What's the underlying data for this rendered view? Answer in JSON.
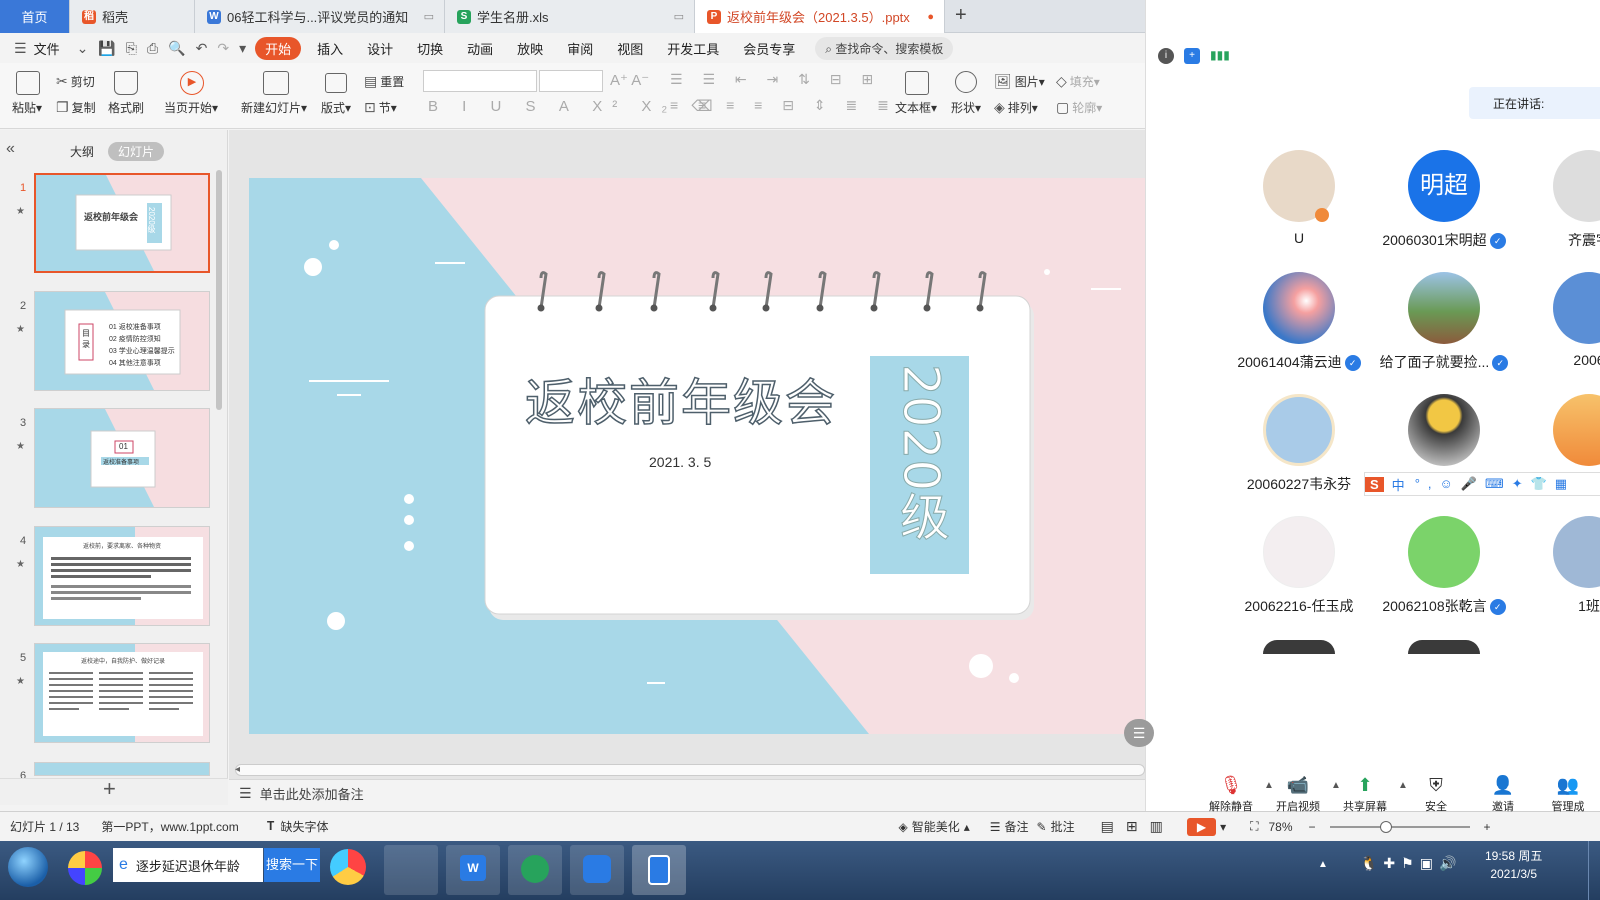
{
  "tabs": {
    "home": "首页",
    "daoke": "稻壳",
    "doc": "06轻工科学与...评议党员的通知",
    "xls": "学生名册.xls",
    "pptx": "返校前年级会（2021.3.5）.pptx",
    "add": "+"
  },
  "menu": {
    "file": "文件",
    "items": [
      "开始",
      "插入",
      "设计",
      "切换",
      "动画",
      "放映",
      "审阅",
      "视图",
      "开发工具",
      "会员专享"
    ],
    "search": "查找命令、搜索模板"
  },
  "ribbon": {
    "paste": "粘贴",
    "cut": "剪切",
    "copy": "复制",
    "format_painter": "格式刷",
    "from_current": "当页开始",
    "new_slide": "新建幻灯片",
    "layout": "版式",
    "reset": "重置",
    "section": "节",
    "textbox": "文本框",
    "shape": "形状",
    "picture": "图片",
    "arrange": "排列",
    "fill": "填充",
    "outline": "轮廓"
  },
  "leftpanel": {
    "outline_tab": "大纲",
    "slides_tab": "幻灯片",
    "slide_numbers": [
      "1",
      "2",
      "3",
      "4",
      "5",
      "6"
    ],
    "thumb1_title": "返校前年级会",
    "thumb1_year": "2020级",
    "thumb2_label": "目录",
    "thumb2_items": [
      "01 返校准备事项",
      "02 疫情防控须知",
      "03 学业心理温馨提示",
      "04 其他注意事项"
    ],
    "thumb3_num": "01",
    "thumb3_label": "返校准备事项",
    "thumb4_title": "返校前，要求离家、各种物资",
    "thumb5_title": "返校途中，自我防护、做好记录",
    "add_icon": "+"
  },
  "slide": {
    "title": "返校前年级会",
    "date": "2021. 3. 5",
    "year_label": "2020级"
  },
  "notes_placeholder": "单击此处添加备注",
  "status": {
    "slide_count": "幻灯片 1 / 13",
    "theme": "第一PPT，www.1ppt.com",
    "missing_font": "缺失字体",
    "beautify": "智能美化",
    "notes": "备注",
    "comments": "批注",
    "zoom": "78%"
  },
  "meeting": {
    "speaking": "正在讲话:",
    "participants": [
      {
        "name": "U",
        "avatar_color": "#e8d9c8",
        "mic": false
      },
      {
        "name": "20060301宋明超",
        "avatar_text": "明超",
        "avatar_color": "#1a73e8",
        "mic": true
      },
      {
        "name": "齐震宇",
        "avatar_color": "#dddddd",
        "mic": false
      },
      {
        "name": "20061404蒲云迪",
        "avatar_color": "#6fa8dc",
        "mic": true
      },
      {
        "name": "给了面子就要捡...",
        "avatar_color": "#6a9a55",
        "mic": true
      },
      {
        "name": "2006",
        "avatar_color": "#5b8fd6",
        "mic": false
      },
      {
        "name": "20060227韦永芬",
        "avatar_color": "#a9cbe8",
        "mic": false
      },
      {
        "name": "",
        "avatar_color": "#3a3a3a",
        "mic": false
      },
      {
        "name": "",
        "avatar_color": "#f08a3a",
        "mic": false
      },
      {
        "name": "20062216-任玉成",
        "avatar_color": "#f3eef0",
        "mic": false
      },
      {
        "name": "20062108张乾言",
        "avatar_color": "#7bd36a",
        "mic": true
      },
      {
        "name": "1班",
        "avatar_color": "#9fb8d6",
        "mic": false
      }
    ],
    "ime": {
      "brand": "S",
      "lang": "中"
    },
    "controls": [
      "解除静音",
      "开启视频",
      "共享屏幕",
      "安全",
      "邀请",
      "管理成"
    ]
  },
  "taskbar": {
    "browser_text": "逐步延迟退休年龄",
    "search_btn": "搜索一下",
    "time": "19:58 周五",
    "date": "2021/3/5"
  },
  "colors": {
    "accent": "#e8562a",
    "slide_blue": "#a8d8e8",
    "slide_pink": "#f6dfe2",
    "meeting_blue": "#1a73e8"
  }
}
